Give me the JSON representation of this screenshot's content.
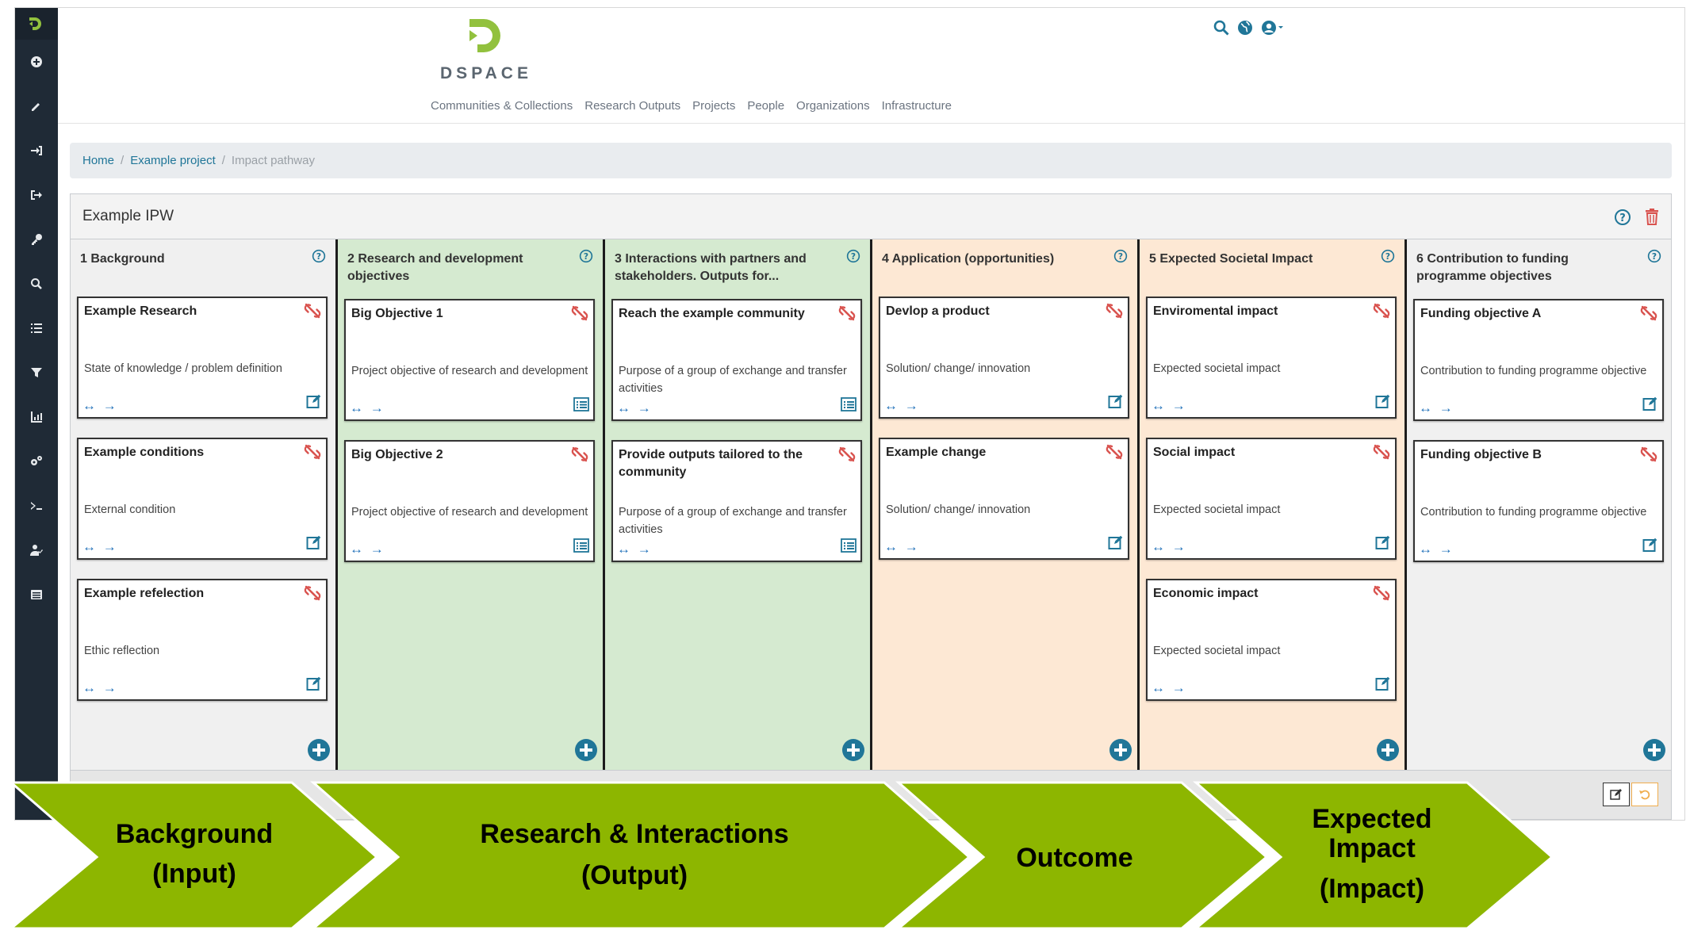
{
  "logo": {
    "text": "DSPACE"
  },
  "nav": [
    "Communities & Collections",
    "Research Outputs",
    "Projects",
    "People",
    "Organizations",
    "Infrastructure"
  ],
  "breadcrumb": {
    "home": "Home",
    "project": "Example project",
    "current": "Impact pathway"
  },
  "panel": {
    "title": "Example IPW"
  },
  "columns": [
    {
      "title": "1 Background",
      "bg": "#f0f0f0",
      "cards": [
        {
          "title": "Example Research",
          "desc": "State of knowledge / problem definition",
          "action": "edit"
        },
        {
          "title": "Example conditions",
          "desc": "External condition",
          "action": "edit"
        },
        {
          "title": "Example refelection",
          "desc": "Ethic reflection",
          "action": "edit"
        }
      ]
    },
    {
      "title": "2 Research and development objectives",
      "bg": "#d5ead0",
      "cards": [
        {
          "title": "Big Objective 1",
          "desc": "Project objective of research and development",
          "action": "list"
        },
        {
          "title": "Big Objective 2",
          "desc": "Project objective of research and development",
          "action": "list"
        }
      ]
    },
    {
      "title": "3 Interactions with partners and stakeholders. Outputs for...",
      "bg": "#d5ead0",
      "cards": [
        {
          "title": "Reach the example community",
          "desc": "Purpose of a group of exchange and transfer activities",
          "action": "list"
        },
        {
          "title": "Provide outputs tailored to the community",
          "desc": "Purpose of a group of exchange and transfer activities",
          "action": "list"
        }
      ]
    },
    {
      "title": "4 Application (opportunities)",
      "bg": "#fde8d4",
      "cards": [
        {
          "title": "Devlop a product",
          "desc": "Solution/ change/ innovation",
          "action": "edit"
        },
        {
          "title": "Example change",
          "desc": "Solution/ change/ innovation",
          "action": "edit"
        }
      ]
    },
    {
      "title": "5 Expected Societal Impact",
      "bg": "#fde8d4",
      "cards": [
        {
          "title": "Enviromental impact",
          "desc": "Expected societal impact",
          "action": "edit"
        },
        {
          "title": "Social impact",
          "desc": "Expected societal impact",
          "action": "edit"
        },
        {
          "title": "Economic impact",
          "desc": "Expected societal impact",
          "action": "edit"
        }
      ]
    },
    {
      "title": "6 Contribution to funding programme objectives",
      "bg": "#f0f0f0",
      "cards": [
        {
          "title": "Funding objective A",
          "desc": "Contribution to funding programme objective",
          "action": "edit"
        },
        {
          "title": "Funding objective B",
          "desc": "Contribution to funding programme objective",
          "action": "edit"
        }
      ]
    }
  ],
  "card_arrows": "↔ →",
  "chevrons": [
    {
      "line1": "Background",
      "line2": "(Input)"
    },
    {
      "line1": "Research & Interactions",
      "line2": "(Output)"
    },
    {
      "line1": "Outcome",
      "line2": ""
    },
    {
      "line1": "Expected",
      "line2": "Impact",
      "line3": "(Impact)"
    }
  ],
  "colors": {
    "chevron_green": "#8db600",
    "accent_blue": "#207698",
    "unlink_red": "#d9534f",
    "sidebar_bg": "#1f2a36",
    "logo_green": "#92c13e"
  },
  "icons": [
    "search-icon",
    "globe-icon",
    "user-icon",
    "help-icon",
    "trash-icon",
    "unlink-icon",
    "edit-icon",
    "list-icon",
    "add-icon",
    "undo-icon"
  ]
}
